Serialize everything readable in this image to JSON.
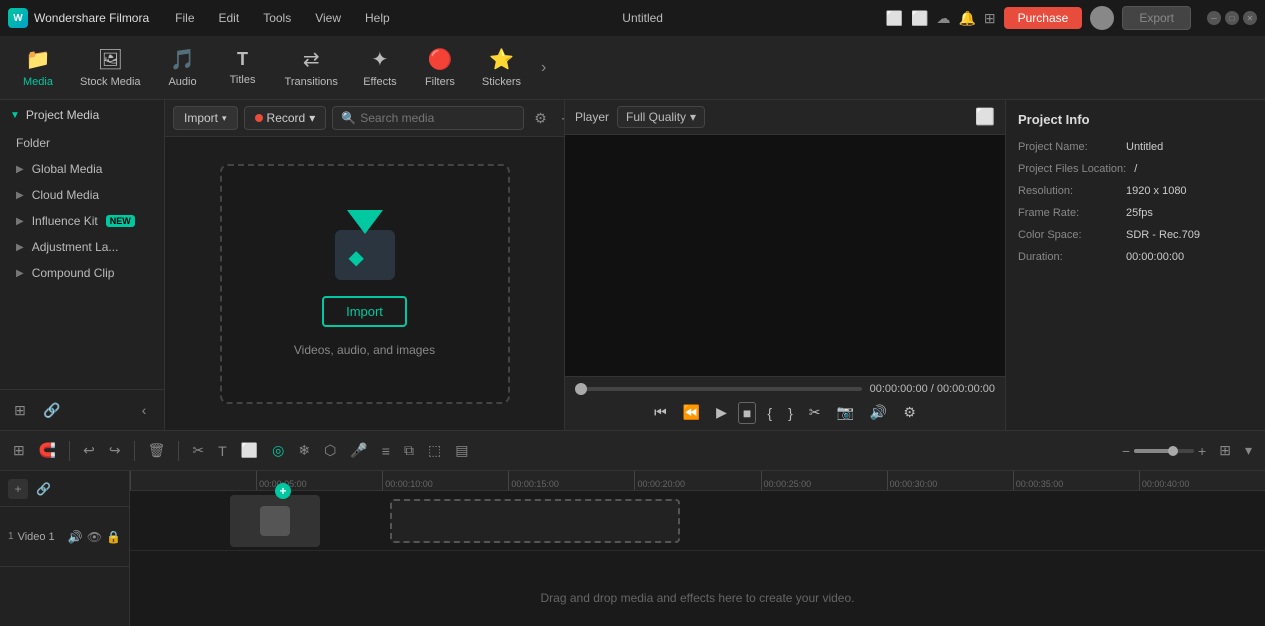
{
  "app": {
    "name": "Wondershare Filmora",
    "title": "Untitled"
  },
  "title_bar": {
    "menu_items": [
      "File",
      "Edit",
      "Tools",
      "View",
      "Help"
    ],
    "purchase_label": "Purchase",
    "export_label": "Export"
  },
  "toolbar": {
    "items": [
      {
        "id": "media",
        "label": "Media",
        "icon": "🎬",
        "active": true
      },
      {
        "id": "stock_media",
        "label": "Stock Media",
        "icon": "📷"
      },
      {
        "id": "audio",
        "label": "Audio",
        "icon": "🎵"
      },
      {
        "id": "titles",
        "label": "Titles",
        "icon": "T"
      },
      {
        "id": "transitions",
        "label": "Transitions",
        "icon": "↔"
      },
      {
        "id": "effects",
        "label": "Effects",
        "icon": "✨"
      },
      {
        "id": "filters",
        "label": "Filters",
        "icon": "🔴"
      },
      {
        "id": "stickers",
        "label": "Stickers",
        "icon": "⭐"
      }
    ]
  },
  "sidebar": {
    "header": "Project Media",
    "items": [
      {
        "id": "folder",
        "label": "Folder"
      },
      {
        "id": "global_media",
        "label": "Global Media"
      },
      {
        "id": "cloud_media",
        "label": "Cloud Media"
      },
      {
        "id": "influence_kit",
        "label": "Influence Kit",
        "badge": "NEW"
      },
      {
        "id": "adjustment_la",
        "label": "Adjustment La..."
      },
      {
        "id": "compound_clip",
        "label": "Compound Clip"
      }
    ],
    "add_label": "+",
    "link_label": "🔗"
  },
  "media_panel": {
    "import_btn": "Import",
    "record_btn": "Record",
    "search_placeholder": "Search media",
    "import_drop": {
      "btn_label": "Import",
      "subtitle": "Videos, audio, and images"
    }
  },
  "player": {
    "label": "Player",
    "quality": "Full Quality",
    "current_time": "00:00:00:00",
    "total_time": "00:00:00:00"
  },
  "project_info": {
    "title": "Project Info",
    "fields": [
      {
        "label": "Project Name:",
        "value": "Untitled"
      },
      {
        "label": "Project Files Location:",
        "value": "/"
      },
      {
        "label": "Resolution:",
        "value": "1920 x 1080"
      },
      {
        "label": "Frame Rate:",
        "value": "25fps"
      },
      {
        "label": "Color Space:",
        "value": "SDR - Rec.709"
      },
      {
        "label": "Duration:",
        "value": "00:00:00:00"
      }
    ]
  },
  "timeline": {
    "track_label": "Video 1",
    "track_number": "1",
    "ruler_marks": [
      "00:00:05:00",
      "00:00:10:00",
      "00:00:15:00",
      "00:00:20:00",
      "00:00:25:00",
      "00:00:30:00",
      "00:00:35:00",
      "00:00:40:00"
    ],
    "drag_hint": "Drag and drop media and effects here to create your video."
  }
}
